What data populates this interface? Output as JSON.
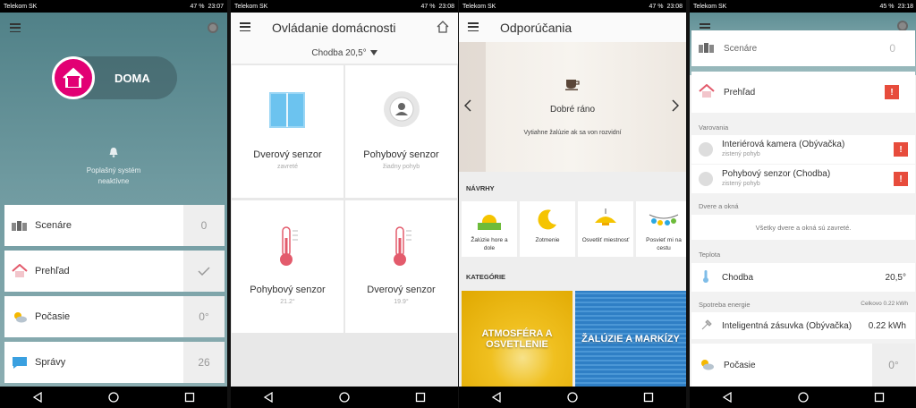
{
  "status": {
    "carrier": "Telekom SK",
    "battery1": "47 %",
    "time1": "23:07",
    "battery2": "47 %",
    "time2": "23:08",
    "battery3": "47 %",
    "time3": "23:08",
    "battery4": "45 %",
    "time4": "23:18"
  },
  "screen1": {
    "mode": "DOMA",
    "alarm_line1": "Poplašný systém",
    "alarm_line2": "neaktívne",
    "cards": [
      {
        "label": "Scenáre",
        "value": "0"
      },
      {
        "label": "Prehľad",
        "value": ""
      },
      {
        "label": "Počasie",
        "value": "0°"
      },
      {
        "label": "Správy",
        "value": "26"
      }
    ]
  },
  "screen2": {
    "title": "Ovládanie domácnosti",
    "room": "Chodba 20,5°",
    "tiles": [
      {
        "name": "Dverový senzor",
        "status": "zavreté"
      },
      {
        "name": "Pohybový senzor",
        "status": "žiadny pohyb"
      },
      {
        "name": "Pohybový senzor",
        "status": "21.2°"
      },
      {
        "name": "Dverový senzor",
        "status": "19.9°"
      }
    ]
  },
  "screen3": {
    "title": "Odporúčania",
    "greeting": "Dobré ráno",
    "desc": "Vytiahne žalúzie ak sa von rozvidní",
    "suggestions_label": "NÁVRHY",
    "categories_label": "KATEGÓRIE",
    "suggestions": [
      {
        "l1": "Žalúzie hore a",
        "l2": "dole"
      },
      {
        "l1": "Zotmenie",
        "l2": ""
      },
      {
        "l1": "Osvetliť miestnosť",
        "l2": ""
      },
      {
        "l1": "Posvieť mi na",
        "l2": "cestu"
      }
    ],
    "categories": [
      {
        "l1": "ATMOSFÉRA A",
        "l2": "OSVETLENIE"
      },
      {
        "l1": "ŽALÚZIE A MARKÍZY",
        "l2": ""
      }
    ]
  },
  "screen4": {
    "scenes_label": "Scenáre",
    "scenes_value": "0",
    "overview": "Prehľad",
    "warnings_label": "Varovania",
    "warnings": [
      {
        "name": "Interiérová kamera (Obývačka)",
        "sub": "zistený pohyb"
      },
      {
        "name": "Pohybový senzor (Chodba)",
        "sub": "zistený pohyb"
      }
    ],
    "doors_label": "Dvere a okná",
    "doors_text": "Všetky dvere a okná sú zavreté.",
    "temp_label": "Teplota",
    "temp_room": "Chodba",
    "temp_value": "20,5°",
    "energy_label": "Spotreba energie",
    "energy_total": "Celkovo 0.22 kWh",
    "energy_device": "Inteligentná zásuvka (Obývačka)",
    "energy_value": "0.22 kWh",
    "weather_label": "Počasie",
    "weather_value": "0°",
    "warn_mark": "!"
  }
}
